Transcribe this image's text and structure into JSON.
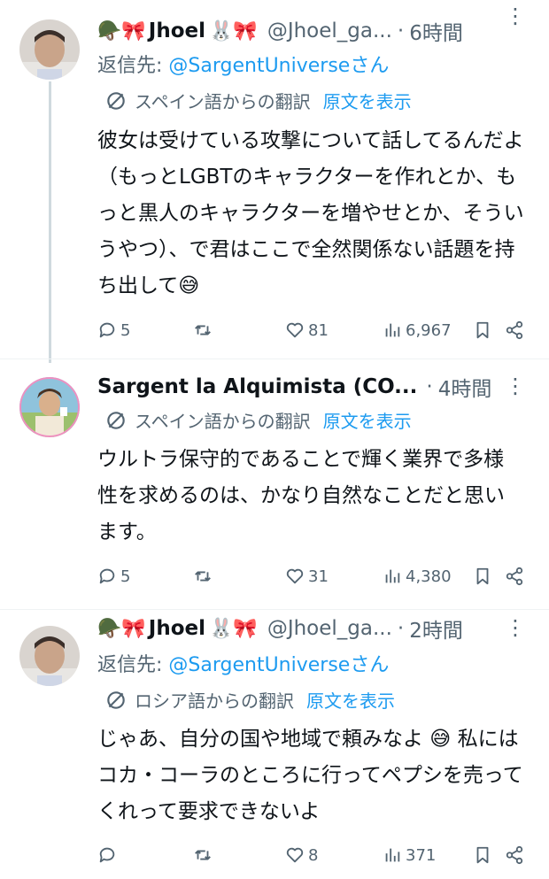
{
  "tweets": [
    {
      "user": {
        "emoji_left": "🪖🎀",
        "display_name": "Jhoel",
        "emoji_right": "🐰🎀",
        "handle": "@Jhoel_ga...",
        "time": "6時間"
      },
      "reply_prefix": "返信先: ",
      "reply_mention": "@SargentUniverseさん",
      "translation_note": "スペイン語からの翻訳",
      "show_original": "原文を表示",
      "text": "彼女は受けている攻撃について話してるんだよ（もっとLGBTのキャラクターを作れとか、もっと黒人のキャラクターを増やせとか、そういうやつ）、で君はここで全然関係ない話題を持ち出して😅",
      "stats": {
        "replies": "5",
        "retweets": "",
        "likes": "81",
        "views": "6,967"
      }
    },
    {
      "user": {
        "emoji_left": "",
        "display_name": "Sargent la Alquimista (CO...",
        "emoji_right": "",
        "handle": "",
        "time": "4時間"
      },
      "translation_note": "スペイン語からの翻訳",
      "show_original": "原文を表示",
      "text": "ウルトラ保守的であることで輝く業界で多様性を求めるのは、かなり自然なことだと思います。",
      "stats": {
        "replies": "5",
        "retweets": "",
        "likes": "31",
        "views": "4,380"
      }
    },
    {
      "user": {
        "emoji_left": "🪖🎀",
        "display_name": "Jhoel",
        "emoji_right": "🐰🎀",
        "handle": "@Jhoel_ga...",
        "time": "2時間"
      },
      "reply_prefix": "返信先: ",
      "reply_mention": "@SargentUniverseさん",
      "translation_note": "ロシア語からの翻訳",
      "show_original": "原文を表示",
      "text": "じゃあ、自分の国や地域で頼みなよ 😅 私にはコカ・コーラのところに行ってペプシを売ってくれって要求できないよ",
      "stats": {
        "replies": "",
        "retweets": "",
        "likes": "8",
        "views": "371"
      }
    }
  ],
  "separator_dot": "·",
  "icons": {
    "more": "more-dots-icon",
    "translate": "translate-icon",
    "reply": "reply-icon",
    "retweet": "retweet-icon",
    "like": "heart-icon",
    "views": "views-icon",
    "bookmark": "bookmark-icon",
    "share": "share-icon"
  },
  "colors": {
    "text": "#0f1419",
    "secondary": "#536471",
    "link": "#1d9bf0",
    "divider": "#eff3f4",
    "thread_line": "#cfd9de"
  }
}
